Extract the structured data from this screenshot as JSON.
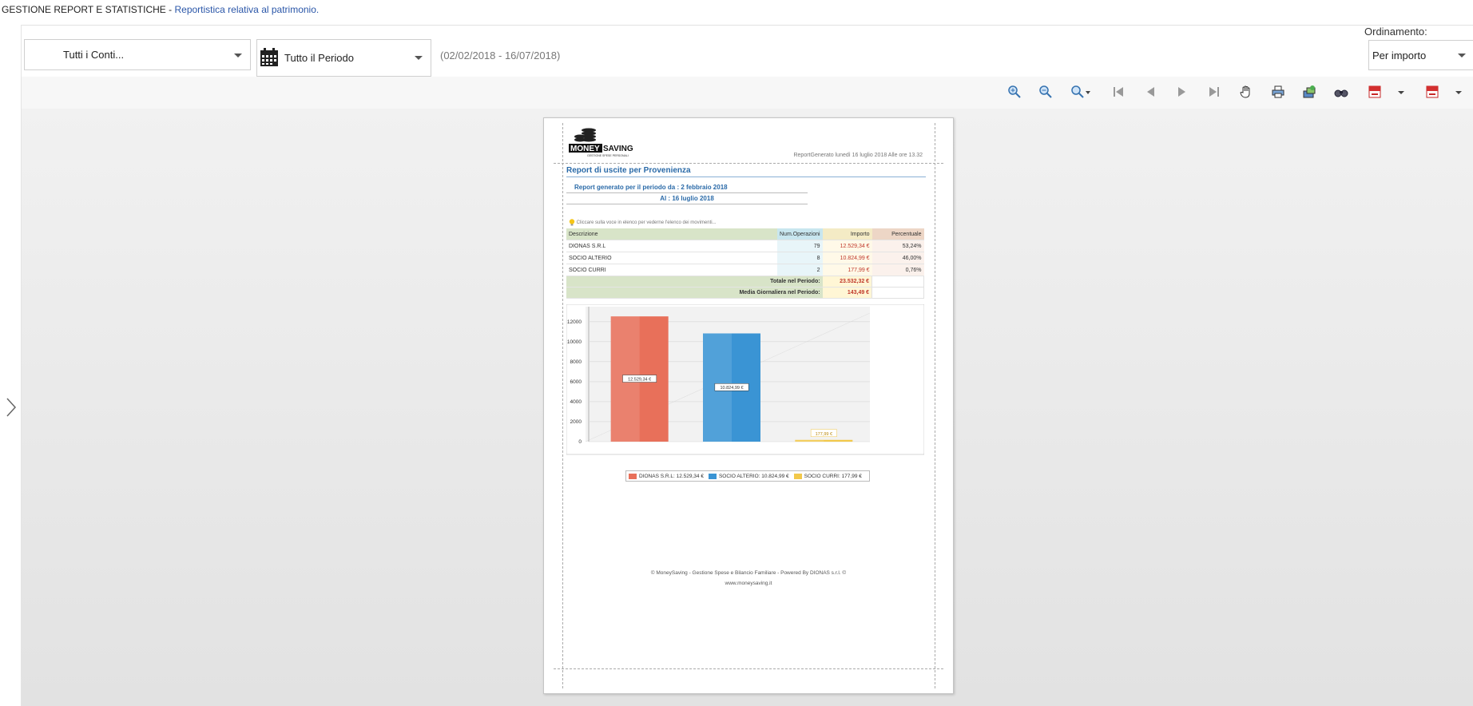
{
  "header": {
    "title": "GESTIONE REPORT E STATISTICHE - ",
    "subtitle": "Reportistica relativa al patrimonio."
  },
  "filters": {
    "conti": "Tutti i Conti...",
    "periodo": "Tutto il Periodo",
    "date_range": "(02/02/2018 - 16/07/2018)",
    "ordinamento_label": "Ordinamento:",
    "ordinamento_value": "Per importo"
  },
  "toolbar": {
    "icons": [
      "zoom-in-icon",
      "zoom-out-icon",
      "zoom-dropdown-icon",
      "first-page-icon",
      "prev-page-icon",
      "next-page-icon",
      "last-page-icon",
      "hand-tool-icon",
      "print-icon",
      "export-icon",
      "find-icon",
      "pdf-icon",
      "pdf-dropdown-icon",
      "pdf-save-icon",
      "pdf-save-dropdown-icon"
    ]
  },
  "report": {
    "logo_text": "MONEYSAVING",
    "logo_tagline": "GESTIONE SPESE PERSONALI",
    "generated": "ReportGenerato lunedì 16 luglio 2018 Alle ore 13.32",
    "title": "Report di uscite per Provenienza",
    "period_from": "Report generato per il periodo da : 2 febbraio 2018",
    "period_to": "Al : 16 luglio 2018",
    "hint": "Cliccare sulla voce in elenco per vederne l'elenco dei movimenti...",
    "table": {
      "headers": [
        "Descrizione",
        "Num.Operazioni",
        "Importo",
        "Percentuale"
      ],
      "rows": [
        [
          "DIONAS S.R.L",
          "79",
          "12.529,34 €",
          "53,24%"
        ],
        [
          "SOCIO ALTERIO",
          "8",
          "10.824,99 €",
          "46,00%"
        ],
        [
          "SOCIO CURRI",
          "2",
          "177,99 €",
          "0,76%"
        ]
      ],
      "totale_label": "Totale nel Periodo:",
      "totale_value": "23.532,32 €",
      "media_label": "Media Giornaliera nel Periodo:",
      "media_value": "143,49 €"
    },
    "footer1": "© MoneySaving - Gestione Spese e Bilancio Familiare - Powered By DIONAS s.r.l. ©",
    "footer2": "www.moneysaving.it"
  },
  "chart_data": {
    "type": "bar",
    "categories": [
      "DIONAS S.R.L",
      "SOCIO ALTERIO",
      "SOCIO CURRI"
    ],
    "values": [
      12529.34,
      10824.99,
      177.99
    ],
    "value_labels": [
      "12.529,34 €",
      "10.824,99 €",
      "177,99 €"
    ],
    "colors": [
      "#e8705a",
      "#3a94d4",
      "#f2c84a"
    ],
    "yticks": [
      0,
      2000,
      4000,
      6000,
      8000,
      10000,
      12000
    ],
    "ylim": [
      0,
      13500
    ],
    "legend": [
      "DIONAS S.R.L: 12.529,34 €",
      "SOCIO ALTERIO: 10.824,99 €",
      "SOCIO CURRI: 177,99 €"
    ],
    "grid": true
  }
}
